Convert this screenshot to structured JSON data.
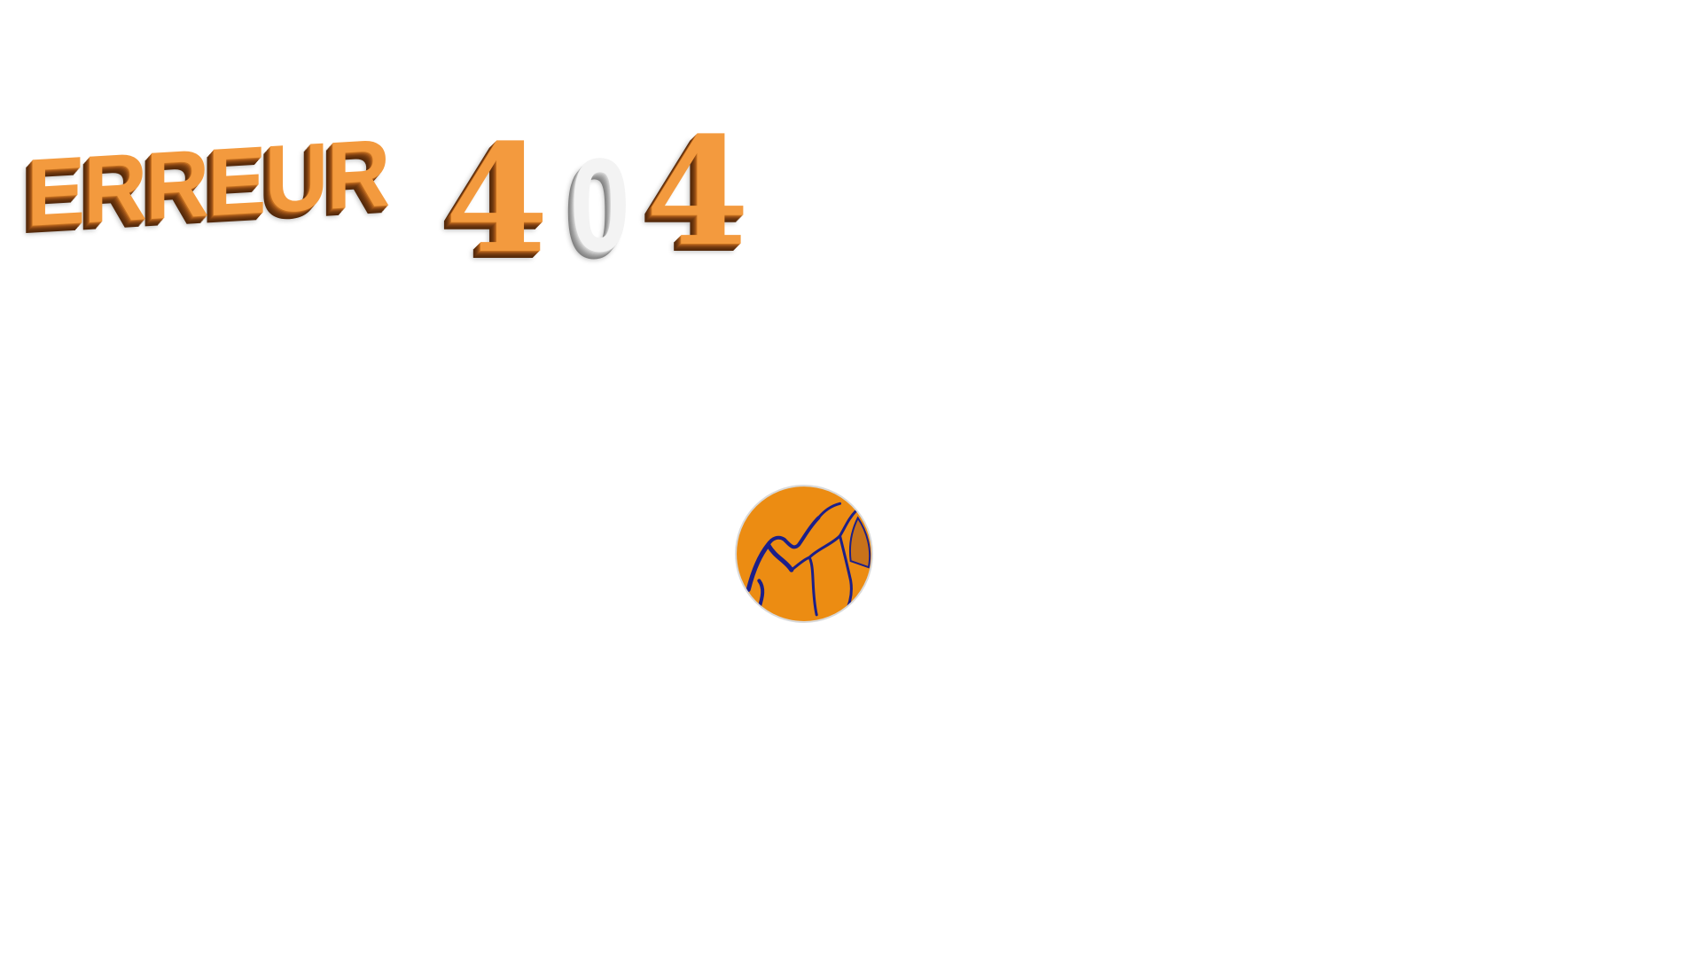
{
  "error": {
    "word": "ERREUR",
    "digits": [
      "4",
      "0",
      "4"
    ]
  },
  "colors": {
    "orange": "#f39a3e",
    "orange_side": "#6d370e",
    "grey": "#f3f3f3",
    "grey_side": "#9d9d9d",
    "globe_fill": "#ec8c12",
    "globe_lines": "#1c1f8a"
  },
  "icons": {
    "globe": "globe-icon"
  }
}
